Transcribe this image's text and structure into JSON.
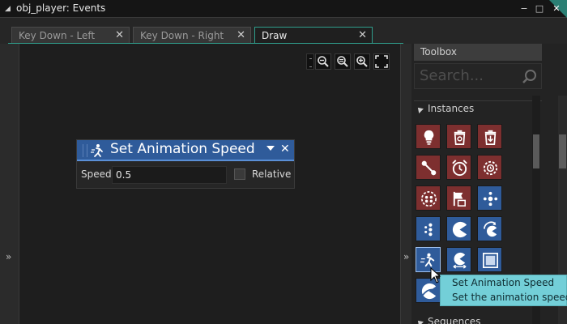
{
  "window": {
    "title": "obj_player: Events",
    "minimize_glyph": "−",
    "restore_glyph": "□",
    "close_glyph": "✕"
  },
  "tabs": [
    {
      "label": "Key Down - Left",
      "close": "✕"
    },
    {
      "label": "Key Down - Right",
      "close": "✕"
    },
    {
      "label": "Draw",
      "close": "✕"
    }
  ],
  "gutter_arrows": {
    "left": "»",
    "right": "»"
  },
  "zoom_tools": [
    "zoom-out-icon",
    "zoom-reset-icon",
    "zoom-in-icon",
    "fullscreen-icon"
  ],
  "action": {
    "title": "Set Animation Speed",
    "close": "✕",
    "fields": {
      "speed_label": "Speed",
      "speed_value": "0.5",
      "relative_label": "Relative",
      "relative_checked": false
    }
  },
  "toolbox": {
    "title": "Toolbox",
    "search_placeholder": "Search...",
    "section_instances": "Instances",
    "section_sequences": "Sequences",
    "buttons": [
      {
        "icon": "create-instance-icon",
        "color": "red"
      },
      {
        "icon": "destroy-instance-icon",
        "color": "red"
      },
      {
        "icon": "change-instance-icon",
        "color": "red"
      },
      {
        "icon": "move-instance-icon",
        "color": "red"
      },
      {
        "icon": "alarm-icon",
        "color": "red"
      },
      {
        "icon": "alarm-settings-icon",
        "color": "red"
      },
      {
        "icon": "instance-count-icon",
        "color": "red"
      },
      {
        "icon": "instance-flag-icon",
        "color": "red"
      },
      {
        "icon": "sprite-frames-icon",
        "color": "blue"
      },
      {
        "icon": "sprite-list-icon",
        "color": "blue"
      },
      {
        "icon": "set-sprite-icon",
        "color": "blue"
      },
      {
        "icon": "rotate-sprite-icon",
        "color": "blue"
      },
      {
        "icon": "animation-speed-icon",
        "color": "blue"
      },
      {
        "icon": "scale-sprite-icon",
        "color": "blue"
      },
      {
        "icon": "sprite-alpha-icon",
        "color": "blue"
      },
      {
        "icon": "sprite-variable-icon",
        "color": "blue"
      }
    ]
  },
  "tooltip": {
    "title": "Set Animation Speed",
    "description": "Set the animation speed o"
  },
  "colors": {
    "accent_teal": "#2f9e8c",
    "action_blue": "#2f5b9a",
    "instance_red": "#7d2f2f",
    "tooltip_bg": "#73cfd8"
  }
}
